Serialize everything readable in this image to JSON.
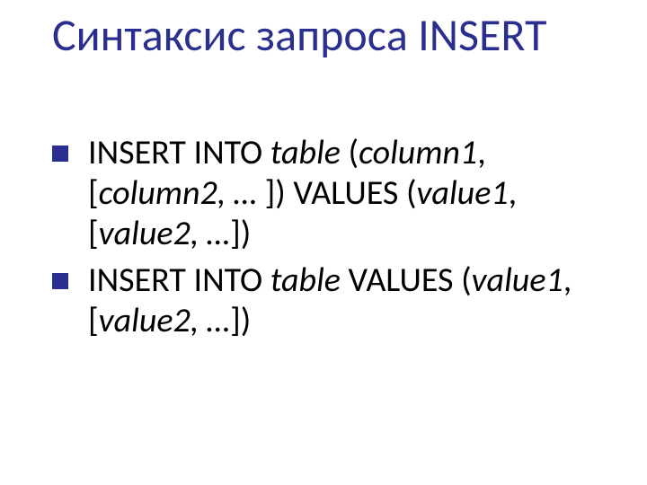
{
  "title": "Синтаксис запроса INSERT",
  "bullets": [
    {
      "p1a": "INSERT INTO ",
      "p1b_table": "table",
      "p2_open": "(",
      "p2_col1": "column1",
      "p2_comma": ", [",
      "p2_col2": "column2, …",
      "p2_close": " ]) VALUES (",
      "p2_val1": "value1",
      "p2_comma2": ", [",
      "p2_val2": "value2, …",
      "p2_close2": "])"
    },
    {
      "p1a": "INSERT INTO ",
      "p1b_table": "table",
      "p2_vals": " VALUES (",
      "p2_val1": "value1",
      "p2_comma": ", [",
      "p2_val2": "value2, …",
      "p2_close": "])"
    }
  ]
}
